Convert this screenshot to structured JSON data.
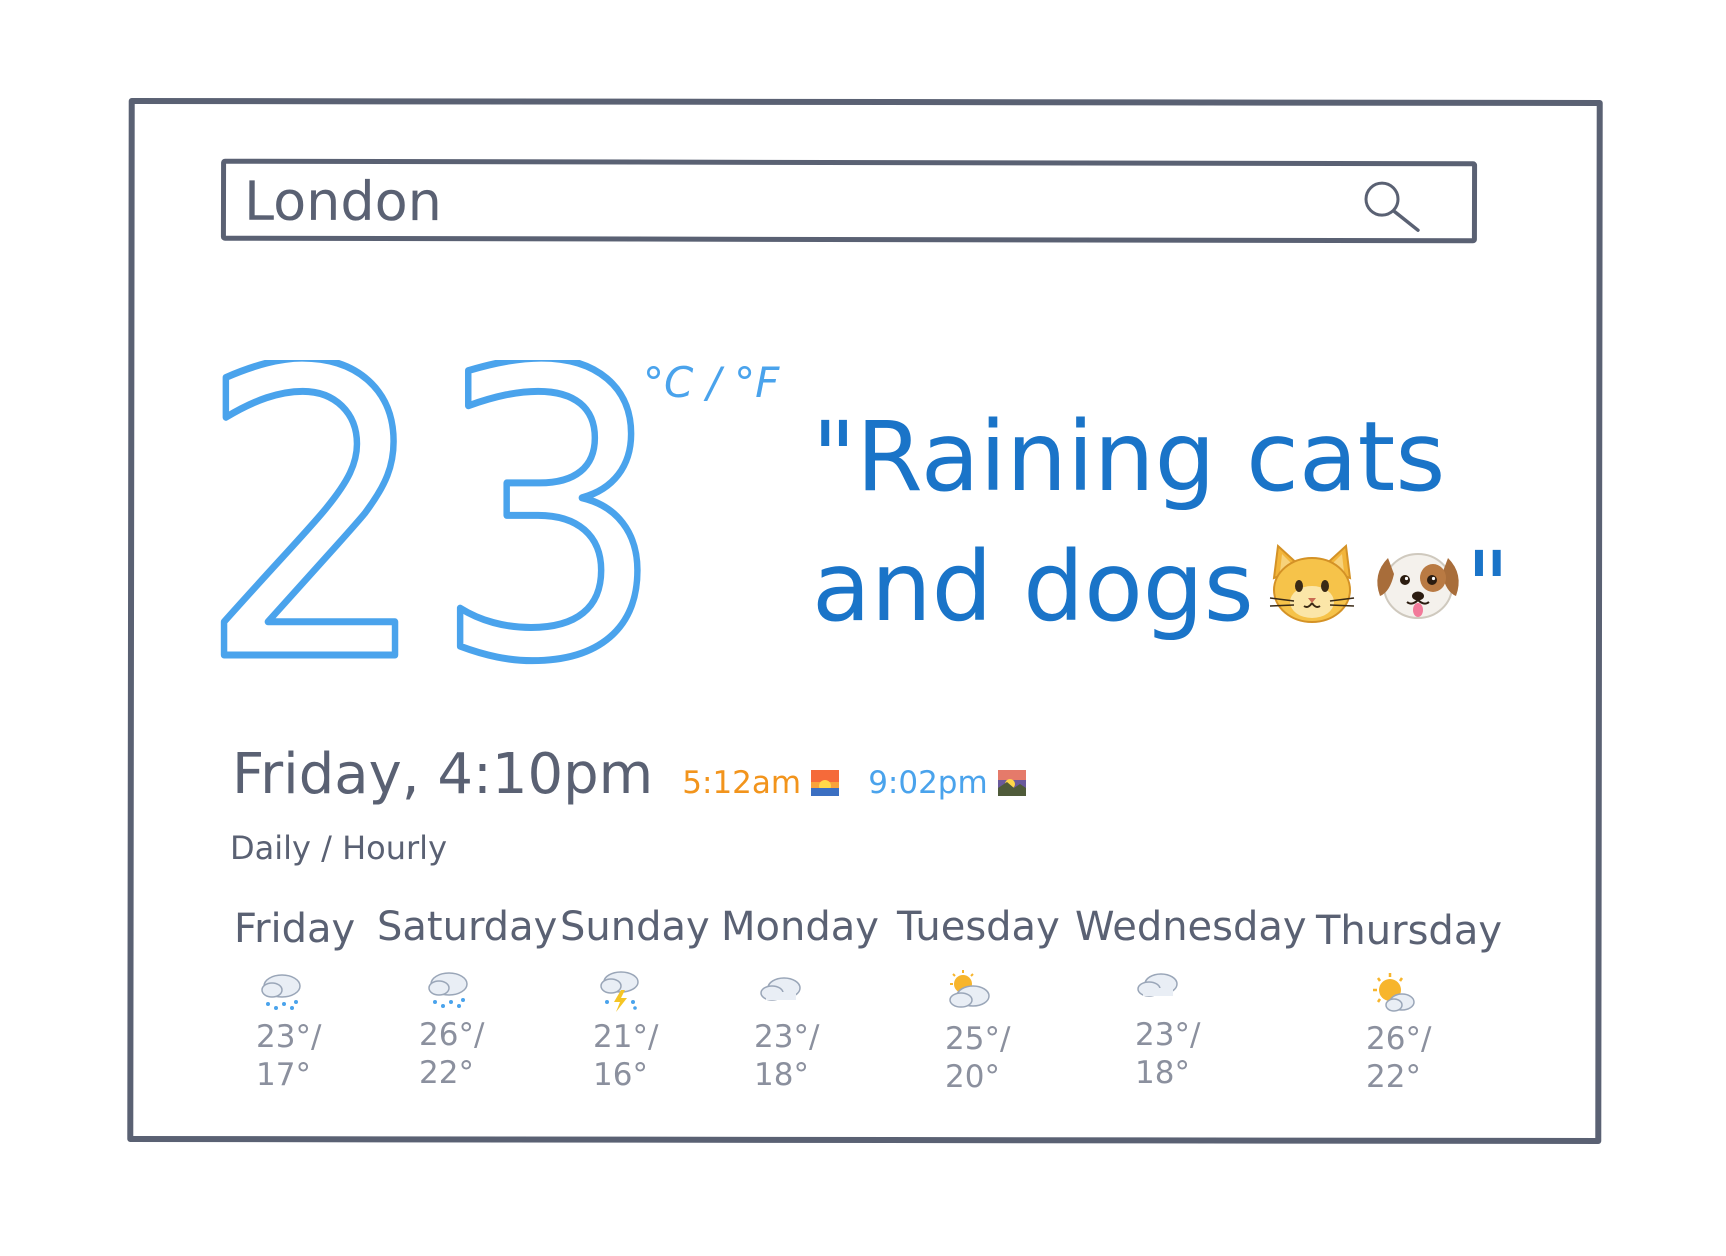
{
  "search": {
    "value": "London",
    "icon": "search-icon"
  },
  "current": {
    "temperature": "23",
    "unit_toggle": "°C / °F",
    "condition_line1": "\"Raining cats",
    "condition_line2": "and dogs",
    "condition_close": "\"",
    "emoji": [
      "cat-face-icon",
      "dog-face-icon"
    ],
    "datetime": "Friday, 4:10pm",
    "sunrise": "5:12am",
    "sunset": "9:02pm"
  },
  "view_toggle": "Daily / Hourly",
  "colors": {
    "accent_blue": "#4aa3ec",
    "condition_blue": "#1a74c8",
    "sunrise_orange": "#f2941c",
    "ink": "#5a6173",
    "muted": "#8b909e"
  },
  "forecast": [
    {
      "day": "Friday",
      "icon": "rain-cloud-icon",
      "high": "23°/",
      "low": "17°"
    },
    {
      "day": "Saturday",
      "icon": "rain-cloud-icon",
      "high": "26°/",
      "low": "22°"
    },
    {
      "day": "Sunday",
      "icon": "thunderstorm-icon",
      "high": "21°/",
      "low": "16°"
    },
    {
      "day": "Monday",
      "icon": "cloud-icon",
      "high": "23°/",
      "low": "18°"
    },
    {
      "day": "Tuesday",
      "icon": "sun-behind-cloud-icon",
      "high": "25°/",
      "low": "20°"
    },
    {
      "day": "Wednesday",
      "icon": "cloud-icon",
      "high": "23°/",
      "low": "18°"
    },
    {
      "day": "Thursday",
      "icon": "sun-behind-small-cloud-icon",
      "high": "26°/",
      "low": "22°"
    }
  ]
}
